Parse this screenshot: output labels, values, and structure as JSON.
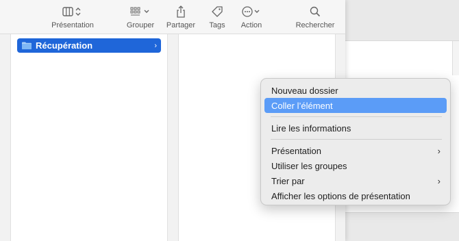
{
  "toolbar": {
    "items": [
      {
        "label": "Présentation",
        "icon": "columns-view-icon"
      },
      {
        "label": "Grouper",
        "icon": "group-grid-icon"
      },
      {
        "label": "Partager",
        "icon": "share-icon"
      },
      {
        "label": "Tags",
        "icon": "tag-icon"
      },
      {
        "label": "Action",
        "icon": "ellipsis-circle-icon"
      },
      {
        "label": "Rechercher",
        "icon": "search-icon"
      }
    ]
  },
  "sidebar": {
    "selected_item": {
      "label": "Récupération",
      "icon": "folder-icon",
      "chevron": "›"
    }
  },
  "context_menu": {
    "items": [
      {
        "label": "Nouveau dossier"
      },
      {
        "label": "Coller l’élément",
        "highlighted": true
      },
      {
        "label": "Lire les informations"
      },
      {
        "label": "Présentation",
        "submenu": true
      },
      {
        "label": "Utiliser les groupes"
      },
      {
        "label": "Trier par",
        "submenu": true
      },
      {
        "label": "Afficher les options de présentation"
      }
    ],
    "submenu_arrow": "›"
  },
  "colors": {
    "selection": "#1f66d9",
    "menu_highlight": "#5b9cf7"
  }
}
